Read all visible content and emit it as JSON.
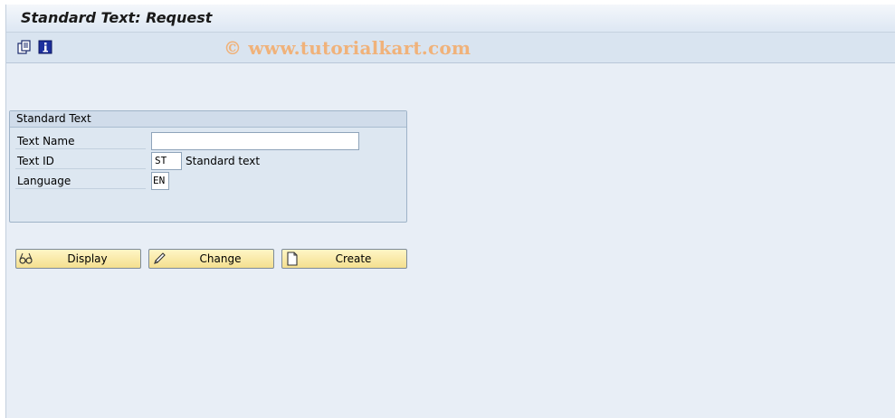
{
  "window": {
    "title": "Standard Text: Request"
  },
  "toolbar": {
    "icons": [
      "other-object-icon",
      "info-icon"
    ],
    "watermark": "© www.tutorialkart.com"
  },
  "group": {
    "title": "Standard Text",
    "fields": [
      {
        "label": "Text Name",
        "value": ""
      },
      {
        "label": "Text ID",
        "value": "ST",
        "description": "Standard text"
      },
      {
        "label": "Language",
        "value": "EN"
      }
    ]
  },
  "buttons": [
    {
      "label": "Display",
      "icon": "glasses-icon"
    },
    {
      "label": "Change",
      "icon": "pencil-icon"
    },
    {
      "label": "Create",
      "icon": "new-document-icon"
    }
  ]
}
